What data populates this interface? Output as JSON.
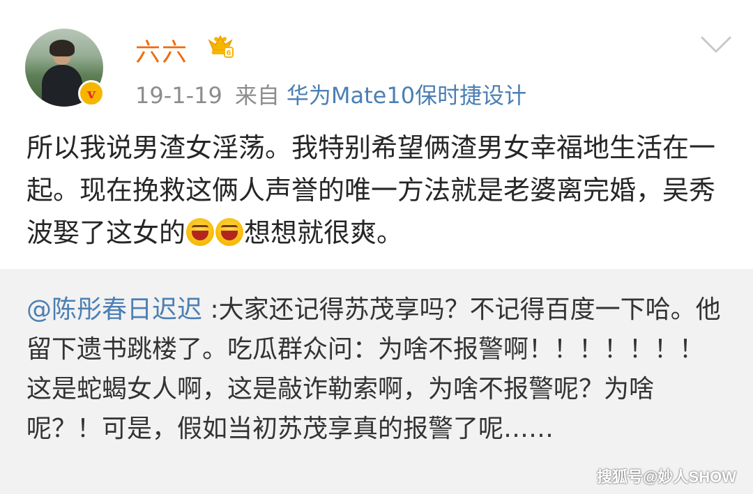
{
  "post": {
    "author": {
      "name": "六六"
    },
    "meta": {
      "date": "19-1-19",
      "from_label": "来自",
      "device": "华为Mate10保时捷设计"
    },
    "text": {
      "part1": "所以我说男渣女淫荡。我特别希望俩渣男女幸福地生活在一起。现在挽救这俩人声誉的唯一方法就是老婆离完婚，吴秀波娶了这女的",
      "part2": "想想就很爽。"
    },
    "emojis": [
      "laughing-emoji",
      "laughing-emoji"
    ]
  },
  "repost": {
    "mention": "@陈彤春日迟迟",
    "text": " :大家还记得苏茂享吗？不记得百度一下哈。他留下遗书跳楼了。吃瓜群众问：为啥不报警啊！！！！！！！这是蛇蝎女人啊，这是敲诈勒索啊，为啥不报警呢？为啥呢？！可是，假如当初苏茂享真的报警了呢……"
  },
  "watermark": {
    "text": "搜狐号@妙人SHOW"
  },
  "colors": {
    "username": "#f06b0f",
    "link": "#4b7fb3",
    "meta_gray": "#8c8c8c",
    "repost_bg": "#f2f2f2"
  },
  "icons": [
    "avatar",
    "verified-badge-icon",
    "vip-crown-icon",
    "chevron-down-icon",
    "laughing-emoji"
  ]
}
